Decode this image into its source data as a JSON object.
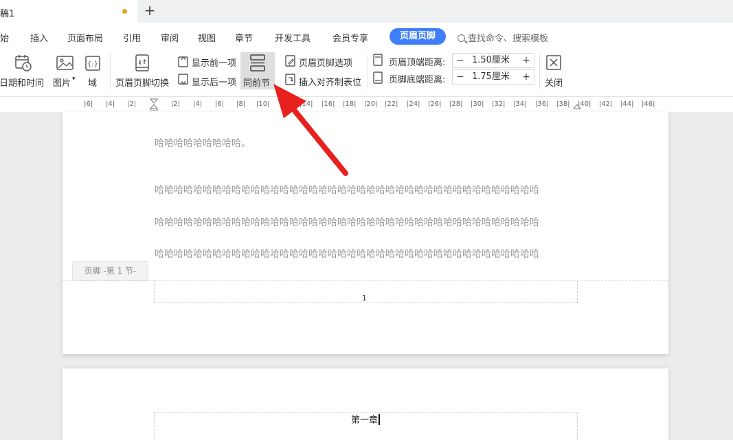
{
  "tab": {
    "title": "稿1",
    "new_tab_symbol": "+"
  },
  "menu": {
    "items": [
      "开始",
      "插入",
      "页面布局",
      "引用",
      "审阅",
      "视图",
      "章节",
      "开发工具",
      "会员专享"
    ],
    "active": "页眉页脚",
    "search_text": "查找命令、搜索模板",
    "accent_color": "#3e7ef8"
  },
  "ribbon": {
    "datetime_label": "日期和时间",
    "picture_label": "图片",
    "field_label": "域",
    "switch_label": "页眉页脚切换",
    "show_prev_label": "显示前一项",
    "show_next_label": "显示后一项",
    "same_as_prev_label": "同前节",
    "hf_options_label": "页眉页脚选项",
    "insert_tab_label": "插入对齐制表位",
    "header_top_label": "页眉顶端距离:",
    "header_top_value": "1.50厘米",
    "footer_bottom_label": "页脚底端距离:",
    "footer_bottom_value": "1.75厘米",
    "minus": "−",
    "plus": "+",
    "close_label": "关闭"
  },
  "ruler": {
    "ticks": [
      "6",
      "4",
      "2",
      "2",
      "4",
      "6",
      "8",
      "10",
      "12",
      "14",
      "16",
      "18",
      "20",
      "22",
      "24",
      "26",
      "28",
      "30",
      "32",
      "34",
      "36",
      "38",
      "40",
      "42",
      "44",
      "46"
    ]
  },
  "document": {
    "lines": [
      "哈哈哈哈哈哈哈哈哈。",
      "哈哈哈哈哈哈哈哈哈哈哈哈哈哈哈哈哈哈哈哈哈哈哈哈哈哈哈哈哈哈哈哈哈哈哈哈哈哈哈哈",
      "哈哈哈哈哈哈哈哈哈哈哈哈哈哈哈哈哈哈哈哈哈哈哈哈哈哈哈哈哈哈哈哈哈哈哈哈哈哈哈哈",
      "哈哈哈哈哈哈哈哈哈哈哈哈哈哈哈哈哈哈哈哈哈哈哈哈哈哈哈哈哈哈哈哈哈哈哈哈哈哈哈哈"
    ],
    "footer_label": "页脚 -第 1 节-",
    "page_number": "1",
    "next_header_text": "第一章"
  },
  "annotation": {
    "arrow_color": "#e8201e"
  }
}
